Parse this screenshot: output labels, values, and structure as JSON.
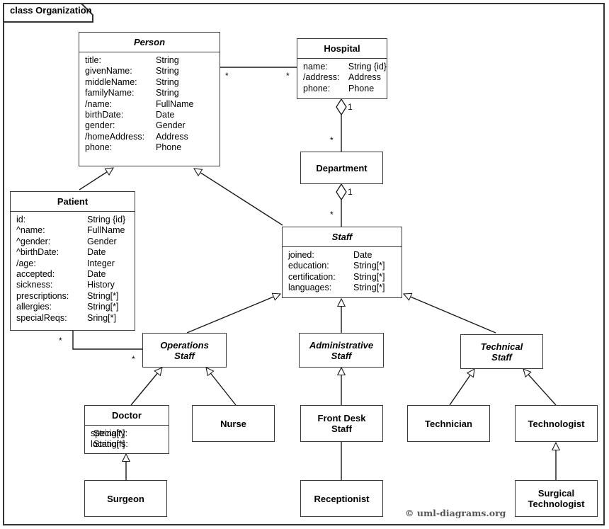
{
  "frame": {
    "label": "class Organization"
  },
  "copyright": "© uml-diagrams.org",
  "classes": {
    "person": {
      "name": "Person",
      "attributes": [
        {
          "name": "title:",
          "type": "String"
        },
        {
          "name": "givenName:",
          "type": "String"
        },
        {
          "name": "middleName:",
          "type": "String"
        },
        {
          "name": "familyName:",
          "type": "String"
        },
        {
          "name": "/name:",
          "type": "FullName"
        },
        {
          "name": "birthDate:",
          "type": "Date"
        },
        {
          "name": "gender:",
          "type": "Gender"
        },
        {
          "name": "/homeAddress:",
          "type": "Address"
        },
        {
          "name": "phone:",
          "type": "Phone"
        }
      ]
    },
    "hospital": {
      "name": "Hospital",
      "attributes": [
        {
          "name": "name:",
          "type": "String {id}"
        },
        {
          "name": "/address:",
          "type": "Address"
        },
        {
          "name": "phone:",
          "type": "Phone"
        }
      ]
    },
    "department": {
      "name": "Department"
    },
    "patient": {
      "name": "Patient",
      "attributes": [
        {
          "name": "id:",
          "type": "String {id}"
        },
        {
          "name": "^name:",
          "type": "FullName"
        },
        {
          "name": "^gender:",
          "type": "Gender"
        },
        {
          "name": "^birthDate:",
          "type": "Date"
        },
        {
          "name": "/age:",
          "type": "Integer"
        },
        {
          "name": "accepted:",
          "type": "Date"
        },
        {
          "name": "sickness:",
          "type": "History"
        },
        {
          "name": "prescriptions:",
          "type": "String[*]"
        },
        {
          "name": "allergies:",
          "type": "String[*]"
        },
        {
          "name": "specialReqs:",
          "type": "Sring[*]"
        }
      ]
    },
    "staff": {
      "name": "Staff",
      "attributes": [
        {
          "name": "joined:",
          "type": "Date"
        },
        {
          "name": "education:",
          "type": "String[*]"
        },
        {
          "name": "certification:",
          "type": "String[*]"
        },
        {
          "name": "languages:",
          "type": "String[*]"
        }
      ]
    },
    "operations_staff": {
      "name": "Operations\nStaff"
    },
    "administrative_staff": {
      "name": "Administrative\nStaff"
    },
    "technical_staff": {
      "name": "Technical\nStaff"
    },
    "doctor": {
      "name": "Doctor",
      "attributes": [
        {
          "name": "specialty:",
          "type": "String[*]"
        },
        {
          "name": "locations:",
          "type": "String[*]"
        }
      ]
    },
    "nurse": {
      "name": "Nurse"
    },
    "front_desk_staff": {
      "name": "Front Desk\nStaff"
    },
    "technician": {
      "name": "Technician"
    },
    "technologist": {
      "name": "Technologist"
    },
    "surgeon": {
      "name": "Surgeon"
    },
    "receptionist": {
      "name": "Receptionist"
    },
    "surgical_technologist": {
      "name": "Surgical\nTechnologist"
    }
  },
  "multiplicities": {
    "person_hospital_person_end": "*",
    "person_hospital_hospital_end": "*",
    "hospital_department_hospital_end": "1",
    "hospital_department_department_end": "*",
    "department_staff_department_end": "1",
    "department_staff_staff_end": "*",
    "patient_operations_patient_end": "*",
    "patient_operations_operations_end": "*"
  },
  "relationships": [
    {
      "type": "association",
      "from": "Person",
      "to": "Hospital"
    },
    {
      "type": "composition",
      "from": "Hospital",
      "to": "Department"
    },
    {
      "type": "composition",
      "from": "Department",
      "to": "Staff"
    },
    {
      "type": "generalization",
      "from": "Patient",
      "to": "Person"
    },
    {
      "type": "generalization",
      "from": "Staff",
      "to": "Person"
    },
    {
      "type": "association",
      "from": "Patient",
      "to": "Operations Staff"
    },
    {
      "type": "generalization",
      "from": "Operations Staff",
      "to": "Staff"
    },
    {
      "type": "generalization",
      "from": "Administrative Staff",
      "to": "Staff"
    },
    {
      "type": "generalization",
      "from": "Technical Staff",
      "to": "Staff"
    },
    {
      "type": "generalization",
      "from": "Doctor",
      "to": "Operations Staff"
    },
    {
      "type": "generalization",
      "from": "Nurse",
      "to": "Operations Staff"
    },
    {
      "type": "generalization",
      "from": "Front Desk Staff",
      "to": "Administrative Staff"
    },
    {
      "type": "generalization",
      "from": "Technician",
      "to": "Technical Staff"
    },
    {
      "type": "generalization",
      "from": "Technologist",
      "to": "Technical Staff"
    },
    {
      "type": "generalization",
      "from": "Surgeon",
      "to": "Doctor"
    },
    {
      "type": "generalization",
      "from": "Receptionist",
      "to": "Front Desk Staff"
    },
    {
      "type": "generalization",
      "from": "Surgical Technologist",
      "to": "Technologist"
    }
  ],
  "colors": {
    "line": "#3a3a3a",
    "background": "#ffffff",
    "text": "#000000"
  }
}
